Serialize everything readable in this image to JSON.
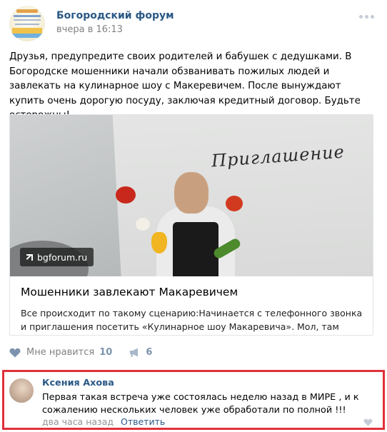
{
  "post": {
    "group_name": "Богородский форум",
    "time": "вчера в 16:13",
    "text": "Друзья, предупредите своих родителей и бабушек с дедушками. В Богородске мошенники начали обзванивать пожилых людей и завлекать на кулинарное шоу с Макеревичем. После вынуждают купить очень дорогую посуду, заключая кредитный договор. Будьте осторожны!"
  },
  "link_card": {
    "image_caption": "Приглашение",
    "domain": "bgforum.ru",
    "title": "Мошенники завлекают Макаревичем",
    "description": "Все происходит по такому сценарию:Начинается с телефонного звонка и приглашения посетить «Кулинарное шоу Макаревича». Мол, там будут..."
  },
  "actions": {
    "like_label": "Мне нравится",
    "like_count": "10",
    "share_count": "6",
    "icons": [
      "heart-icon",
      "megaphone-icon"
    ],
    "like_color": "#7d93ad"
  },
  "comment": {
    "author": "Ксения Ахова",
    "text": "Первая такая встреча уже состоялась неделю назад в МИРЕ , и к сожалению нескольких человек уже обработали по полной !!!",
    "time": "два часа назад",
    "reply_label": "Ответить",
    "highlight_color": "#e0303a"
  },
  "colors": {
    "link": "#2a5885",
    "meta": "#828282"
  }
}
